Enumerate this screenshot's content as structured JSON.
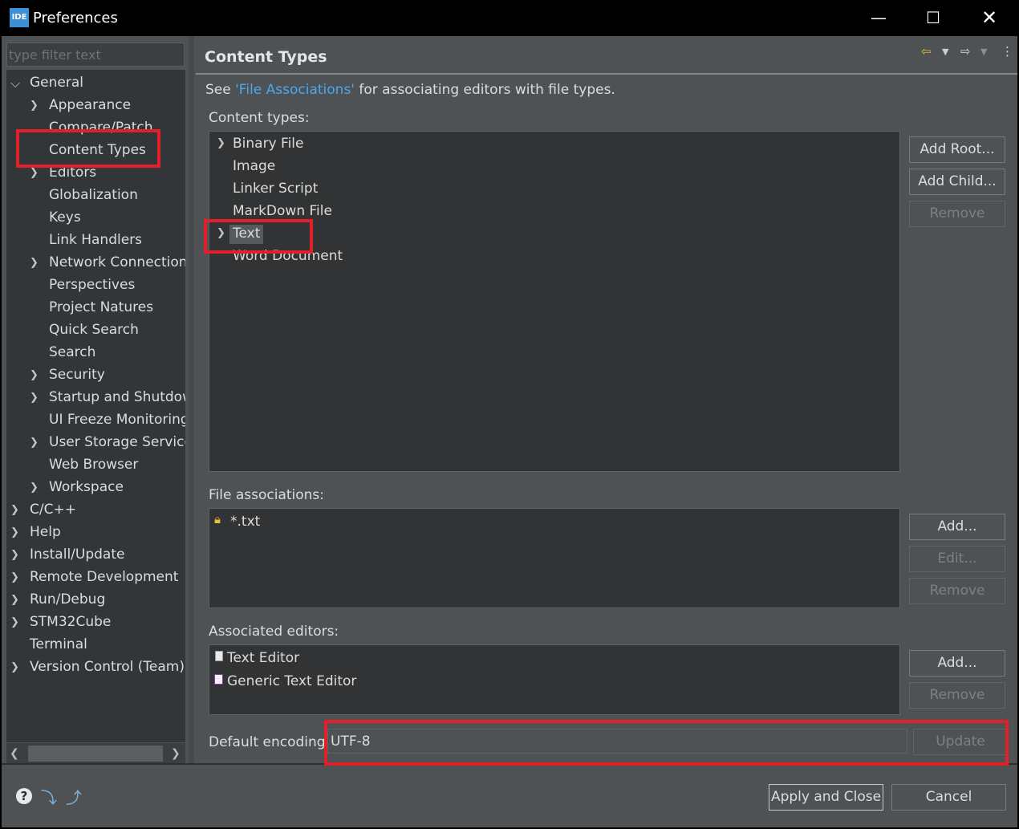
{
  "window": {
    "app_icon_text": "IDE",
    "title": "Preferences",
    "minimize_glyph": "—",
    "maximize_glyph": "☐",
    "close_glyph": "✕"
  },
  "filter": {
    "placeholder": "type filter text"
  },
  "tree": {
    "items": [
      {
        "label": "General",
        "level": 0,
        "expander": "expanded"
      },
      {
        "label": "Appearance",
        "level": 1,
        "expander": "collapsed"
      },
      {
        "label": "Compare/Patch",
        "level": 1,
        "expander": "none"
      },
      {
        "label": "Content Types",
        "level": 1,
        "expander": "none"
      },
      {
        "label": "Editors",
        "level": 1,
        "expander": "collapsed"
      },
      {
        "label": "Globalization",
        "level": 1,
        "expander": "none"
      },
      {
        "label": "Keys",
        "level": 1,
        "expander": "none"
      },
      {
        "label": "Link Handlers",
        "level": 1,
        "expander": "none"
      },
      {
        "label": "Network Connections",
        "level": 1,
        "expander": "collapsed"
      },
      {
        "label": "Perspectives",
        "level": 1,
        "expander": "none"
      },
      {
        "label": "Project Natures",
        "level": 1,
        "expander": "none"
      },
      {
        "label": "Quick Search",
        "level": 1,
        "expander": "none"
      },
      {
        "label": "Search",
        "level": 1,
        "expander": "none"
      },
      {
        "label": "Security",
        "level": 1,
        "expander": "collapsed"
      },
      {
        "label": "Startup and Shutdown",
        "level": 1,
        "expander": "collapsed"
      },
      {
        "label": "UI Freeze Monitoring",
        "level": 1,
        "expander": "none"
      },
      {
        "label": "User Storage Service",
        "level": 1,
        "expander": "collapsed"
      },
      {
        "label": "Web Browser",
        "level": 1,
        "expander": "none"
      },
      {
        "label": "Workspace",
        "level": 1,
        "expander": "collapsed"
      },
      {
        "label": "C/C++",
        "level": 0,
        "expander": "collapsed"
      },
      {
        "label": "Help",
        "level": 0,
        "expander": "collapsed"
      },
      {
        "label": "Install/Update",
        "level": 0,
        "expander": "collapsed"
      },
      {
        "label": "Remote Development",
        "level": 0,
        "expander": "collapsed"
      },
      {
        "label": "Run/Debug",
        "level": 0,
        "expander": "collapsed"
      },
      {
        "label": "STM32Cube",
        "level": 0,
        "expander": "collapsed"
      },
      {
        "label": "Terminal",
        "level": 0,
        "expander": "none"
      },
      {
        "label": "Version Control (Team)",
        "level": 0,
        "expander": "collapsed"
      }
    ]
  },
  "page": {
    "title": "Content Types",
    "description_prefix": "See ",
    "description_link": "'File Associations'",
    "description_suffix": " for associating editors with file types.",
    "content_types_label": "Content types:",
    "content_types": [
      {
        "label": "Binary File",
        "expander": "collapsed"
      },
      {
        "label": "Image",
        "expander": "none"
      },
      {
        "label": "Linker Script",
        "expander": "none"
      },
      {
        "label": "MarkDown File",
        "expander": "none"
      },
      {
        "label": "Text",
        "expander": "collapsed",
        "selected": true
      },
      {
        "label": "Word Document",
        "expander": "none"
      }
    ],
    "content_buttons": {
      "add_root": "Add Root...",
      "add_child": "Add Child...",
      "remove": "Remove"
    },
    "file_assoc_label": "File associations:",
    "file_associations": [
      {
        "label": "*.txt",
        "icon": "lock-icon"
      }
    ],
    "file_buttons": {
      "add": "Add...",
      "edit": "Edit...",
      "remove": "Remove"
    },
    "editors_label": "Associated editors:",
    "editors": [
      {
        "label": "Text Editor",
        "icon": "text-file-icon"
      },
      {
        "label": "Generic Text Editor",
        "icon": "generic-editor-icon"
      }
    ],
    "editor_buttons": {
      "add": "Add...",
      "remove": "Remove"
    },
    "encoding_label": "Default encoding:",
    "encoding_value": "UTF-8",
    "update_button": "Update"
  },
  "footer": {
    "apply_close": "Apply and Close",
    "cancel": "Cancel"
  },
  "colors": {
    "highlight": "#e3202a",
    "link": "#4ea6ea",
    "background": "#4e5254"
  }
}
